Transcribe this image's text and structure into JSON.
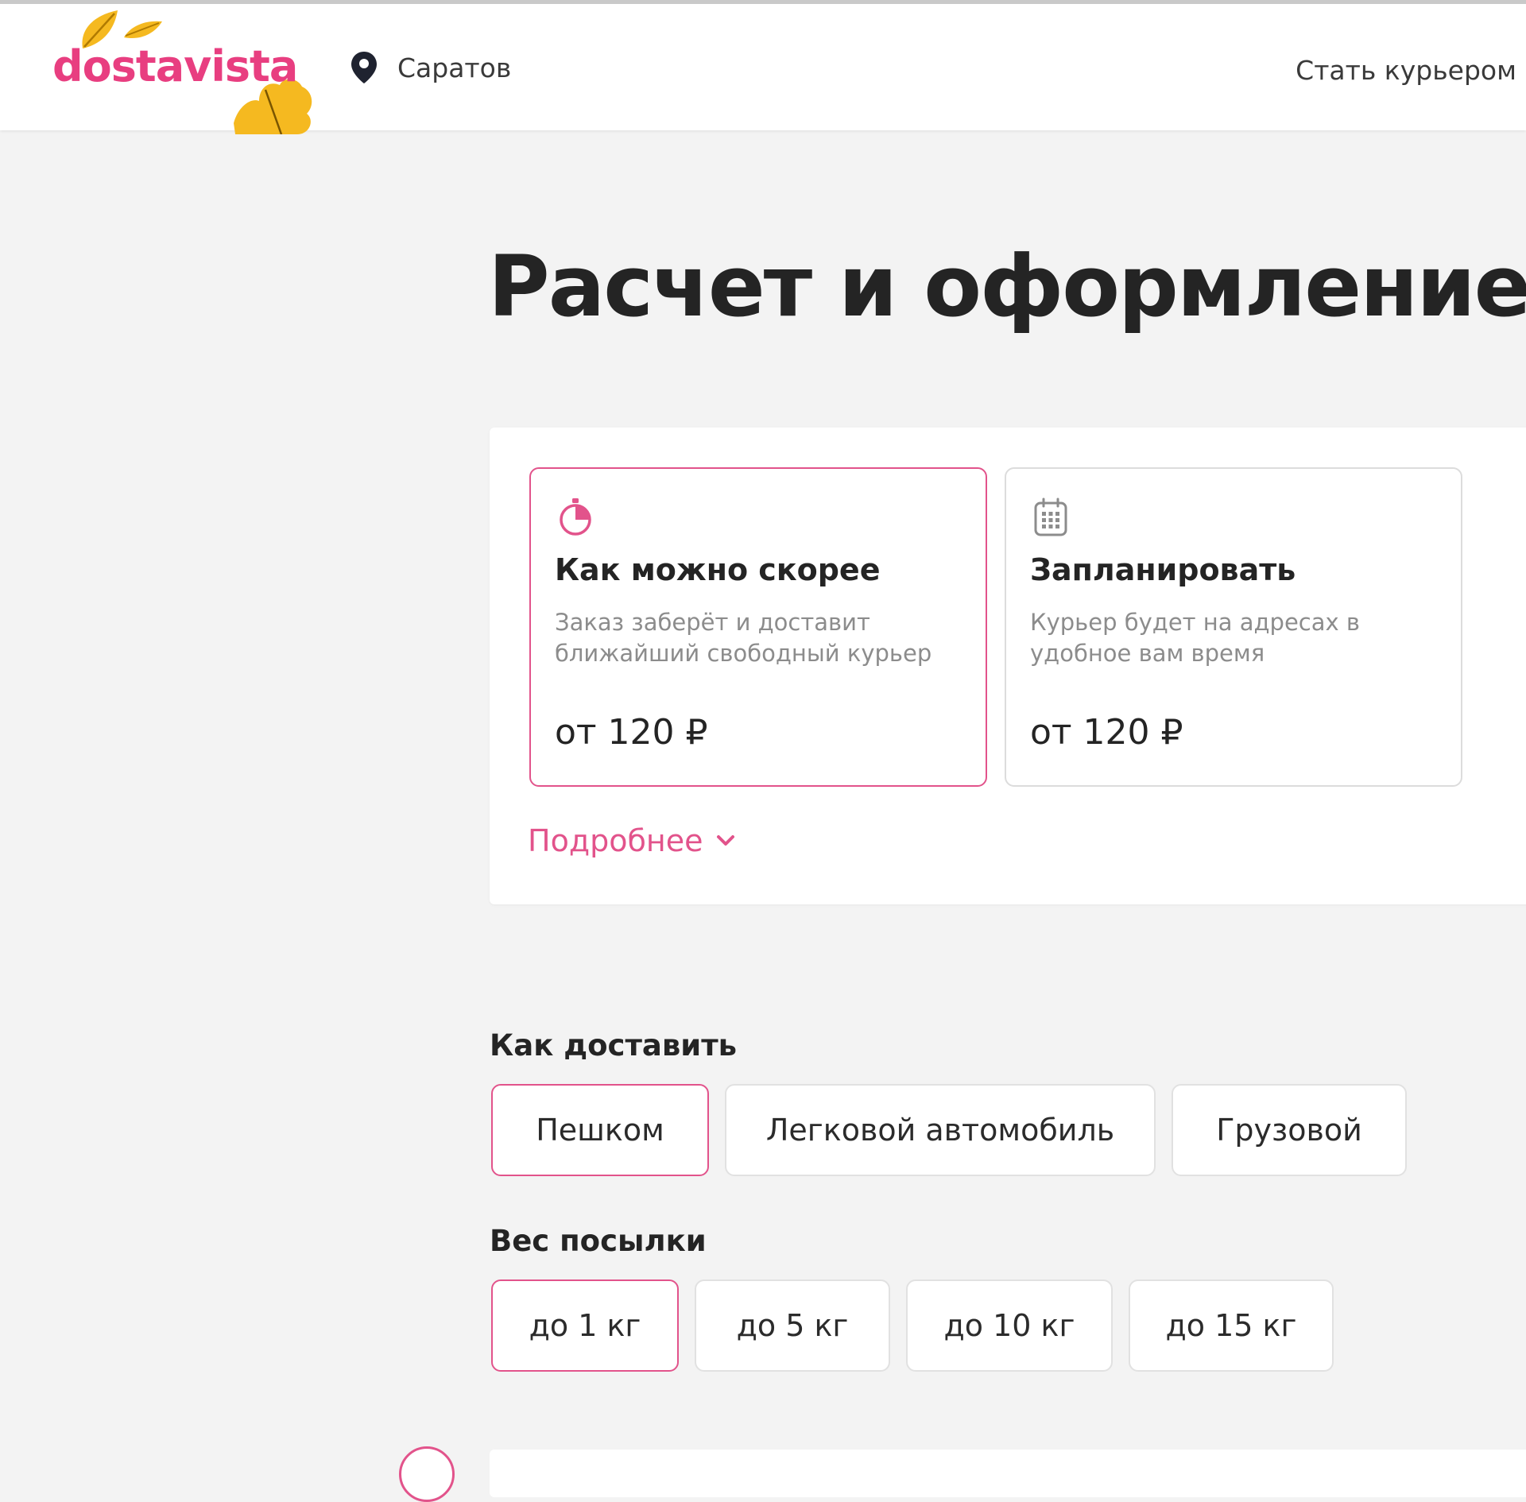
{
  "header": {
    "logo_text": "dostavista",
    "city": "Саратов",
    "become_courier": "Стать курьером"
  },
  "page": {
    "title": "Расчет и оформление"
  },
  "timing": {
    "options": [
      {
        "title": "Как можно скорее",
        "description": "Заказ заберёт и доставит ближайший свободный курьер",
        "price": "от 120 ₽",
        "icon": "stopwatch-icon",
        "selected": true
      },
      {
        "title": "Запланировать",
        "description": "Курьер будет на адресах в удобное вам время",
        "price": "от 120 ₽",
        "icon": "calendar-icon",
        "selected": false
      }
    ],
    "more_label": "Подробнее"
  },
  "transport": {
    "label": "Как доставить",
    "options": [
      "Пешком",
      "Легковой автомобиль",
      "Грузовой"
    ],
    "selected": "Пешком"
  },
  "weight": {
    "label": "Вес посылки",
    "options": [
      "до 1 кг",
      "до 5 кг",
      "до 10 кг",
      "до 15 кг"
    ],
    "selected": "до 1 кг"
  },
  "colors": {
    "accent": "#e2538b",
    "brand": "#e83e80",
    "leaf": "#f5b920",
    "background": "#f3f3f3",
    "text": "#242424",
    "muted": "#8c8c8c"
  }
}
